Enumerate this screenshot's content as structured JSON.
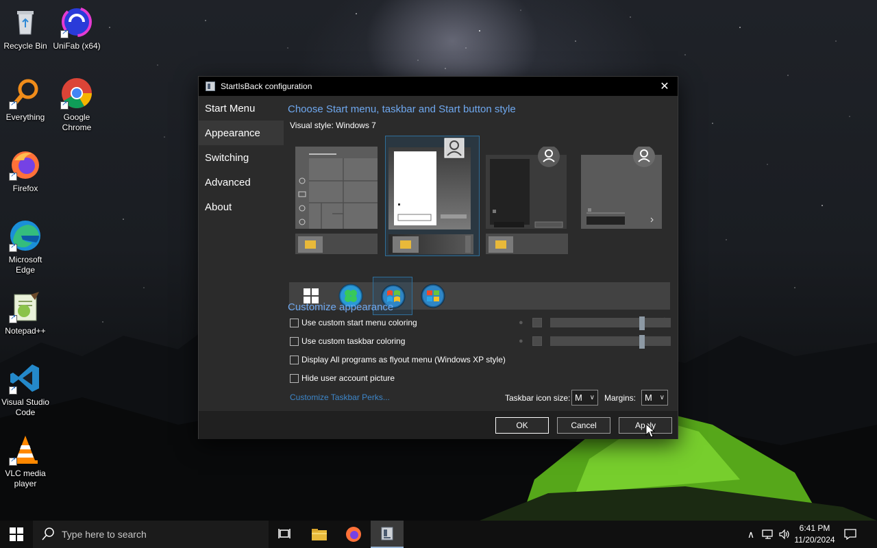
{
  "desktop": {
    "icons": [
      {
        "label": "Recycle Bin",
        "icon": "recycle-bin-icon"
      },
      {
        "label": "UniFab (x64)",
        "icon": "unifab-icon"
      },
      {
        "label": "Everything",
        "icon": "everything-search-icon"
      },
      {
        "label": "Google Chrome",
        "icon": "chrome-icon"
      },
      {
        "label": "Firefox",
        "icon": "firefox-icon"
      },
      {
        "label": "Microsoft Edge",
        "icon": "edge-icon"
      },
      {
        "label": "Notepad++",
        "icon": "notepad-plus-plus-icon"
      },
      {
        "label": "Visual Studio Code",
        "icon": "vscode-icon"
      },
      {
        "label": "VLC media player",
        "icon": "vlc-icon"
      }
    ]
  },
  "dialog": {
    "title": "StartIsBack configuration",
    "sidebar": [
      {
        "label": "Start Menu"
      },
      {
        "label": "Appearance"
      },
      {
        "label": "Switching"
      },
      {
        "label": "Advanced"
      },
      {
        "label": "About"
      }
    ],
    "active_tab": "Appearance",
    "style_heading": "Choose Start menu, taskbar and Start button style",
    "visual_style_label": "Visual style:",
    "visual_style_value": "Windows 7",
    "customize_heading": "Customize appearance",
    "options": [
      {
        "label": "Use custom start menu coloring",
        "checked": false
      },
      {
        "label": "Use custom taskbar coloring",
        "checked": false
      },
      {
        "label": "Display All programs as flyout menu (Windows XP style)",
        "checked": false
      },
      {
        "label": "Hide user account picture",
        "checked": false
      }
    ],
    "link": "Customize Taskbar Perks...",
    "icon_size_label": "Taskbar icon size:",
    "icon_size_value": "M",
    "margins_label": "Margins:",
    "margins_value": "M",
    "buttons": {
      "ok": "OK",
      "cancel": "Cancel",
      "apply": "Apply"
    },
    "colors": {
      "accent_heading": "#6fa8ef",
      "link": "#3d86c9",
      "selection": "#2f6f9a"
    }
  },
  "taskbar": {
    "search_placeholder": "Type here to search",
    "time": "6:41 PM",
    "date": "11/20/2024"
  }
}
